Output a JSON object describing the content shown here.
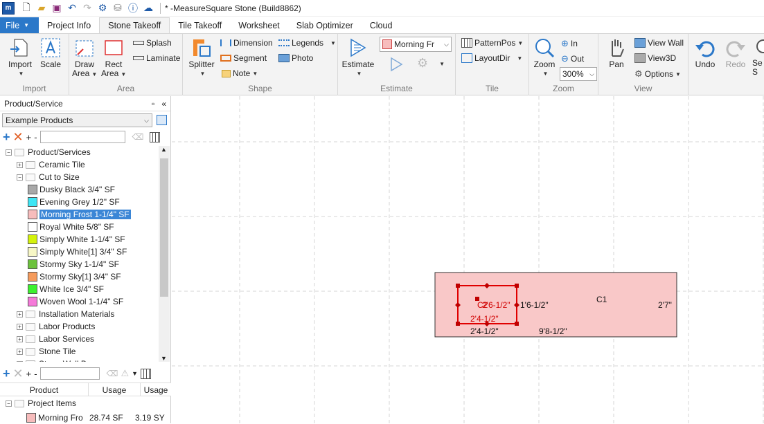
{
  "window": {
    "title": "* -MeasureSquare Stone (Build8862)",
    "app_icon": "m"
  },
  "menu": {
    "file": "File",
    "tabs": [
      "Project Info",
      "Stone Takeoff",
      "Tile Takeoff",
      "Worksheet",
      "Slab Optimizer",
      "Cloud"
    ],
    "active_tab": "Stone Takeoff"
  },
  "ribbon": {
    "import": "Import",
    "scale": "Scale",
    "group_import": "Import",
    "draw_area": "Draw\nArea",
    "rect_area": "Rect\nArea",
    "splash": "Splash",
    "laminate": "Laminate",
    "group_area": "Area",
    "splitter": "Splitter",
    "dimension": "Dimension",
    "segment": "Segment",
    "note": "Note",
    "legends": "Legends",
    "photo": "Photo",
    "group_shape": "Shape",
    "estimate": "Estimate",
    "product_select": "Morning Fr",
    "group_estimate": "Estimate",
    "pattern_pos": "PatternPos",
    "layout_dir": "LayoutDir",
    "group_tile": "Tile",
    "zoom": "Zoom",
    "zoom_in": "In",
    "zoom_out": "Out",
    "zoom_level": "300%",
    "group_zoom": "Zoom",
    "pan": "Pan",
    "view_wall": "View Wall",
    "view3d": "View3D",
    "options": "Options",
    "group_view": "View",
    "undo": "Undo",
    "redo": "Redo",
    "search_partial": "Se S"
  },
  "left_panel": {
    "title": "Product/Service",
    "catalog": "Example Products",
    "tree": [
      {
        "label": "Product/Services",
        "level": 0,
        "type": "folder",
        "expander": "−"
      },
      {
        "label": "Ceramic Tile",
        "level": 1,
        "type": "folder",
        "expander": "+"
      },
      {
        "label": "Cut to Size",
        "level": 1,
        "type": "folder",
        "expander": "−"
      },
      {
        "label": "Dusky Black  3/4\" SF",
        "level": 2,
        "type": "item",
        "color": "#a8a8a8"
      },
      {
        "label": "Evening Grey  1/2\" SF",
        "level": 2,
        "type": "item",
        "color": "#3ee6f5"
      },
      {
        "label": "Morning Frost  1-1/4\" SF",
        "level": 2,
        "type": "item",
        "color": "#f7bcbc",
        "selected": true
      },
      {
        "label": "Royal White  5/8\" SF",
        "level": 2,
        "type": "item",
        "color": "#ffffff"
      },
      {
        "label": "Simply White  1-1/4\" SF",
        "level": 2,
        "type": "item",
        "color": "#d4f20a"
      },
      {
        "label": "Simply White[1]  3/4\" SF",
        "level": 2,
        "type": "item",
        "color": "#f7f7c6"
      },
      {
        "label": "Stormy Sky  1-1/4\" SF",
        "level": 2,
        "type": "item",
        "color": "#6cc23d"
      },
      {
        "label": "Stormy Sky[1]  3/4\" SF",
        "level": 2,
        "type": "item",
        "color": "#f59b5c"
      },
      {
        "label": "White Ice  3/4\" SF",
        "level": 2,
        "type": "item",
        "color": "#3cf02e"
      },
      {
        "label": "Woven Wool  1-1/4\" SF",
        "level": 2,
        "type": "item",
        "color": "#f57ad9"
      },
      {
        "label": "Installation Materials",
        "level": 1,
        "type": "folder",
        "expander": "+"
      },
      {
        "label": "Labor Products",
        "level": 1,
        "type": "folder",
        "expander": "+"
      },
      {
        "label": "Labor Services",
        "level": 1,
        "type": "folder",
        "expander": "+"
      },
      {
        "label": "Stone Tile",
        "level": 1,
        "type": "folder",
        "expander": "+"
      },
      {
        "label": "Stone Wall Base",
        "level": 1,
        "type": "folder",
        "expander": "+"
      }
    ],
    "usage_table": {
      "headers": [
        "Product",
        "Usage",
        "Usage"
      ],
      "group": "Project Items",
      "rows": [
        {
          "product": "Morning Fro",
          "usage1": "28.74 SF",
          "usage2": "3.19 SY",
          "color": "#f7bcbc"
        }
      ]
    }
  },
  "drawing": {
    "area_label": "C1",
    "dim_right": "2'7\"",
    "dim_bottom_left": "2'4-1/2\"",
    "dim_bottom_right": "9'8-1/2\"",
    "dim_inner_right": "1'6-1/2\"",
    "sel_width": "2'4-1/2\"",
    "sel_height": "2'6-1/2\"",
    "sel_label": "C2",
    "fill_color": "#f9c8c8",
    "sel_color": "#e00000"
  }
}
